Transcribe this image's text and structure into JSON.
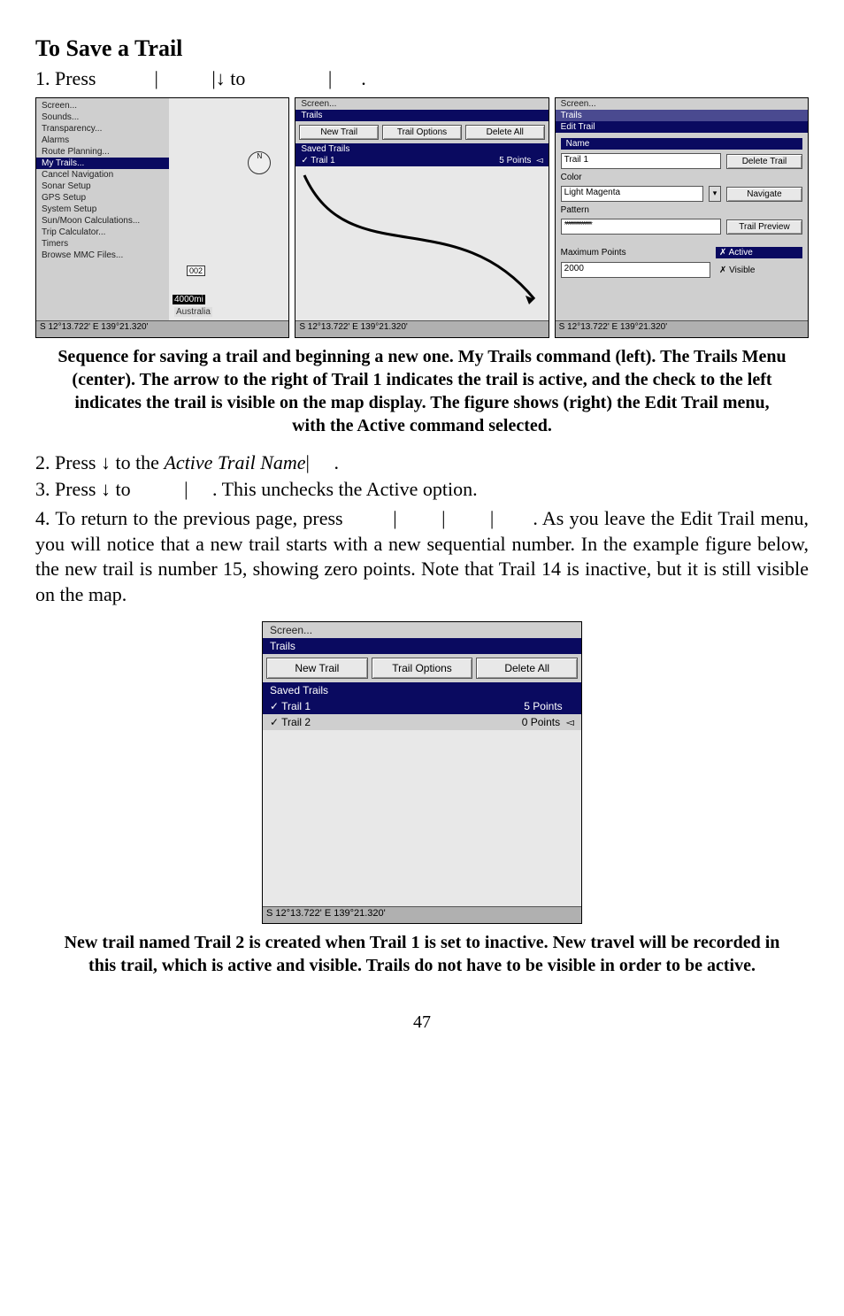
{
  "heading": "To Save a Trail",
  "step1_a": "1. Press",
  "step1_b": "to",
  "arrow_down": "↓",
  "pipe": "|",
  "dot": ".",
  "shot1": {
    "menu": [
      "Screen...",
      "Sounds...",
      "Transparency...",
      "Alarms",
      "Route Planning...",
      "My Trails...",
      "Cancel Navigation",
      "Sonar Setup",
      "GPS Setup",
      "System Setup",
      "Sun/Moon Calculations...",
      "Trip Calculator...",
      "Timers",
      "Browse MMC Files..."
    ],
    "sel_index": 5,
    "map_scale": "4000mi",
    "map_label": "Australia",
    "status": "S   12°13.722'   E  139°21.320'",
    "compass": "002"
  },
  "shot2": {
    "breadcrumb": "Screen...",
    "title": "Trails",
    "buttons": [
      "New Trail",
      "Trail Options",
      "Delete All"
    ],
    "saved_label": "Saved Trails",
    "rows": [
      {
        "name": "✓ Trail 1",
        "pts": "5 Points",
        "arrow": "◅"
      }
    ],
    "status": "S   12°13.722'   E  139°21.320'"
  },
  "shot3": {
    "breadcrumb": "Screen...",
    "title": "Trails",
    "subtitle": "Edit Trail",
    "labels": {
      "name": "Name",
      "color": "Color",
      "pattern": "Pattern",
      "max": "Maximum Points"
    },
    "values": {
      "name": "Trail 1",
      "color": "Light Magenta",
      "pattern": "****************",
      "max": "2000"
    },
    "buttons": {
      "delete": "Delete Trail",
      "navigate": "Navigate",
      "preview": "Trail Preview"
    },
    "checks": {
      "active": "Active",
      "visible": "Visible"
    },
    "status": "S   12°13.722'   E  139°21.320'"
  },
  "caption1": "Sequence for saving a trail and beginning a new one. My Trails command (left). The Trails Menu (center). The arrow to the right of Trail 1 indicates the trail is active, and the check to the left indicates the trail is visible on the map display. The figure shows (right) the Edit Trail menu, with the Active command selected.",
  "step2_a": "2. Press ",
  "step2_b": " to the ",
  "step2_c": "Active Trail Name",
  "step3_a": "3. Press ",
  "step3_b": " to",
  "step3_c": ". This unchecks the Active option.",
  "para4_a": "4. To return to the previous page, press",
  "para4_b": ". As you leave the Edit Trail menu, you will notice that a new trail starts with a new sequential number. In the example figure below, the new trail is number 15, showing zero points. Note that Trail 14 is inactive, but it is still visible on the map.",
  "center_shot": {
    "breadcrumb": "Screen...",
    "title": "Trails",
    "buttons": [
      "New Trail",
      "Trail Options",
      "Delete All"
    ],
    "saved_label": "Saved Trails",
    "rows": [
      {
        "name": "✓ Trail 1",
        "pts": "5 Points",
        "arrow": ""
      },
      {
        "name": "✓ Trail 2",
        "pts": "0 Points",
        "arrow": "◅"
      }
    ],
    "status": "S   12°13.722'   E  139°21.320'"
  },
  "caption2": "New trail named Trail 2 is created when Trail 1 is set to inactive. New travel will be recorded in this trail, which is active and visible. Trails do not have to be visible in order to be active.",
  "page_num": "47",
  "check_x": "✗"
}
